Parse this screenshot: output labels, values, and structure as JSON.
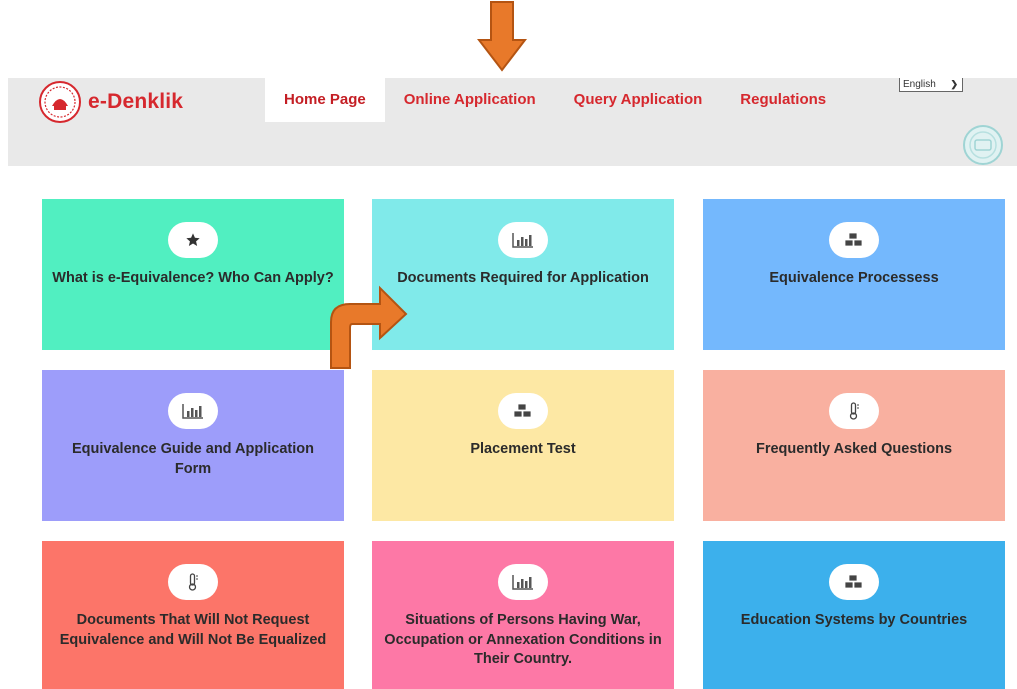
{
  "header": {
    "logo_text": "e-Denklik",
    "nav": [
      {
        "label": "Home Page",
        "active": true
      },
      {
        "label": "Online Application",
        "active": false
      },
      {
        "label": "Query Application",
        "active": false
      },
      {
        "label": "Regulations",
        "active": false
      }
    ],
    "language": "English"
  },
  "cards": [
    {
      "title": "What is e-Equivalence? Who Can Apply?",
      "icon": "star-icon",
      "color": "#51efc1"
    },
    {
      "title": "Documents Required for Application",
      "icon": "bar-chart-icon",
      "color": "#80eaea"
    },
    {
      "title": "Equivalence Processess",
      "icon": "cubes-icon",
      "color": "#74b8fd"
    },
    {
      "title": "Equivalence Guide and Application Form",
      "icon": "bar-chart-icon",
      "color": "#9d9dfa"
    },
    {
      "title": "Placement Test",
      "icon": "cubes-icon",
      "color": "#fde8a4"
    },
    {
      "title": "Frequently Asked Questions",
      "icon": "thermometer-icon",
      "color": "#f9b0a0"
    },
    {
      "title": "Documents That Will Not Request Equivalence and Will Not Be Equalized",
      "icon": "thermometer-icon",
      "color": "#fc7569"
    },
    {
      "title": "Situations of Persons Having War, Occupation or Annexation Conditions in Their Country.",
      "icon": "bar-chart-icon",
      "color": "#fd78a6"
    },
    {
      "title": "Education Systems by Countries",
      "icon": "cubes-icon",
      "color": "#3cb0ec"
    }
  ],
  "annotation_color": "#e8792a"
}
